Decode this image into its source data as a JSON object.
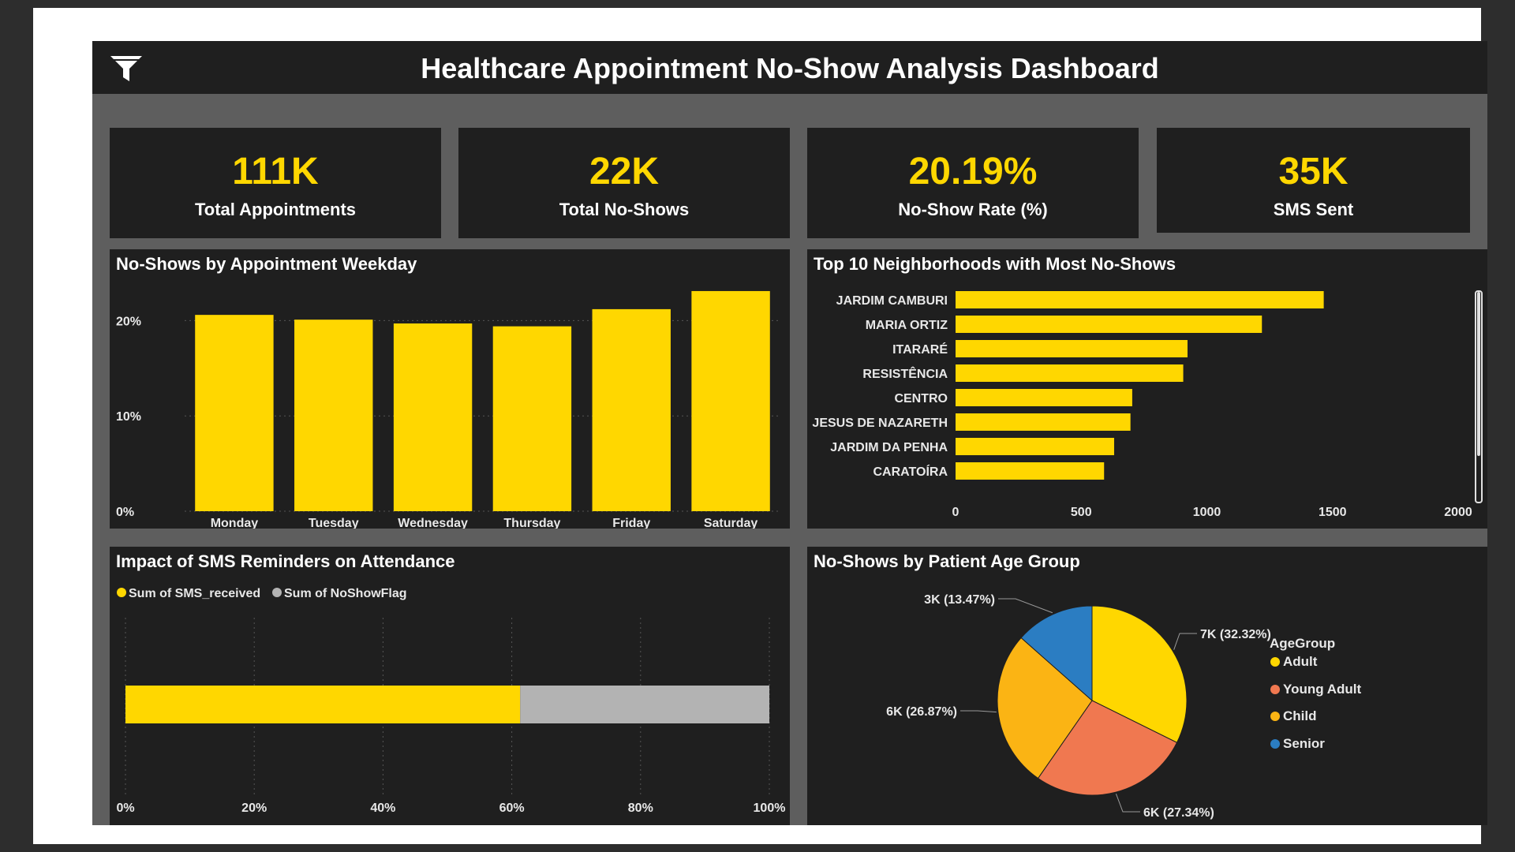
{
  "header": {
    "title": "Healthcare Appointment No-Show Analysis Dashboard",
    "icon": "filter-icon"
  },
  "kpis": [
    {
      "value": "111K",
      "label": "Total Appointments"
    },
    {
      "value": "22K",
      "label": "Total No-Shows"
    },
    {
      "value": "20.19%",
      "label": "No-Show Rate (%)"
    },
    {
      "value": "35K",
      "label": "SMS Sent"
    }
  ],
  "colors": {
    "accent": "#ffd700",
    "grey": "#b3b3b3",
    "young_adult": "#f07850",
    "child": "#fbb414",
    "senior": "#2b7dc2",
    "panel": "#1f1f1f"
  },
  "chart_data": [
    {
      "type": "bar",
      "title": "No-Shows by Appointment Weekday",
      "categories": [
        "Monday",
        "Tuesday",
        "Wednesday",
        "Thursday",
        "Friday",
        "Saturday"
      ],
      "values": [
        20.6,
        20.1,
        19.7,
        19.4,
        21.2,
        23.1
      ],
      "ylim": [
        0,
        25
      ],
      "yticks": [
        "0%",
        "10%",
        "20%"
      ],
      "grid": true
    },
    {
      "type": "bar",
      "orientation": "horizontal",
      "title": "Top 10 Neighborhoods with Most No-Shows",
      "categories": [
        "JARDIM CAMBURI",
        "MARIA ORTIZ",
        "ITARARÉ",
        "RESISTÊNCIA",
        "CENTRO",
        "JESUS DE NAZARETH",
        "JARDIM DA PENHA",
        "CARATOÍRA"
      ],
      "values": [
        1465,
        1219,
        923,
        906,
        703,
        696,
        631,
        591
      ],
      "xlim": [
        0,
        2000
      ],
      "xticks": [
        "0",
        "500",
        "1000",
        "1500",
        "2000"
      ]
    },
    {
      "type": "bar",
      "orientation": "horizontal",
      "stacked": "100%",
      "title": "Impact of SMS Reminders on Attendance",
      "series": [
        {
          "name": "Sum of SMS_received",
          "value": 61.3
        },
        {
          "name": "Sum of NoShowFlag",
          "value": 38.7
        }
      ],
      "xlim": [
        0,
        100
      ],
      "xticks": [
        "0%",
        "20%",
        "40%",
        "60%",
        "80%",
        "100%"
      ],
      "legend": "top-left"
    },
    {
      "type": "pie",
      "title": "No-Shows by Patient Age Group",
      "legend_title": "AgeGroup",
      "legend": "right",
      "slices": [
        {
          "name": "Adult",
          "value": 32.32,
          "label": "7K (32.32%)"
        },
        {
          "name": "Young Adult",
          "value": 27.34,
          "label": "6K (27.34%)"
        },
        {
          "name": "Child",
          "value": 26.87,
          "label": "6K (26.87%)"
        },
        {
          "name": "Senior",
          "value": 13.47,
          "label": "3K (13.47%)"
        }
      ]
    }
  ]
}
